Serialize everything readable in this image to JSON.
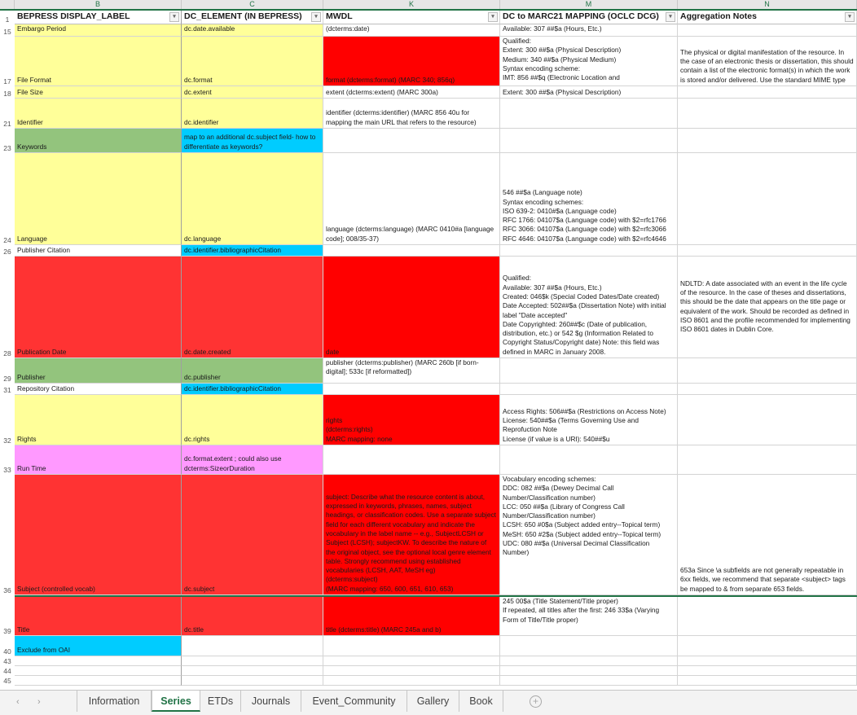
{
  "column_letters": [
    "B",
    "C",
    "K",
    "M",
    "N"
  ],
  "header_row": {
    "row_number": "1",
    "cells": [
      "BEPRESS DISPLAY_LABEL",
      "DC_ELEMENT (IN BEPRESS)",
      "MWDL",
      "DC to MARC21 MAPPING (OCLC DCG)",
      "Aggregation Notes"
    ],
    "filter_icon": "▾"
  },
  "rows": [
    {
      "num": "15",
      "B": "Embargo Period",
      "C": "dc.date.available",
      "K": "(dcterms:date)",
      "M": "Available: 307 ##$a (Hours, Etc.)",
      "N": ""
    },
    {
      "num": "17",
      "B": "File Format",
      "C": "dc.format",
      "K": "format (dcterms:format) (MARC 340; 856q)",
      "M": "Qualified:\nExtent: 300 ##$a (Physical Description)\nMedium: 340 ##$a (Physical Medium)\nSyntax encoding scheme:\nIMT: 856 ##$q (Electronic Location and",
      "N": "The physical or digital manifestation of the resource. In the case of an electronic thesis or dissertation, this should contain a list of the electronic format(s) in which the work is stored and/or delivered. Use the standard MIME type"
    },
    {
      "num": "18",
      "B": "File Size",
      "C": "dc.extent",
      "K": "extent (dcterms:extent) (MARC 300a)",
      "M": "Extent: 300 ##$a (Physical Description)",
      "N": ""
    },
    {
      "num": "21",
      "B": "Identifier",
      "C": "dc.identifier",
      "K": "identifier (dcterms:identifier) (MARC 856 40u for mapping the main URL that refers to the resource)",
      "M": "",
      "N": ""
    },
    {
      "num": "23",
      "B": "Keywords",
      "C": "map to an additional dc.subject field- how to differentiate as keywords?",
      "K": "",
      "M": "",
      "N": ""
    },
    {
      "num": "24",
      "B": "Language",
      "C": "dc.language",
      "K": "language (dcterms:language)  (MARC 0410#a [language code]; 008/35-37)",
      "M": "546 ##$a (Language note)\nSyntax encoding schemes:\nISO 639-2: 0410#$a (Language code)\nRFC 1766: 04107$a (Language code) with $2=rfc1766\nRFC 3066: 04107$a (Language code) with $2=rfc3066\nRFC 4646: 04107$a (Language code) with $2=rfc4646",
      "N": ""
    },
    {
      "num": "26",
      "B": "Publisher Citation",
      "C": "dc.identifier.bibliographicCitation",
      "K": "",
      "M": "",
      "N": ""
    },
    {
      "num": "28",
      "B": "Publication Date",
      "C": "dc.date.created",
      "K": "date",
      "M": "Qualified:\nAvailable: 307 ##$a (Hours, Etc.)\nCreated: 046$k (Special Coded Dates/Date created)\nDate Accepted: 502##$a (Dissertation Note) with initial label \"Date accepted\"\nDate Copyrighted: 260##$c (Date of publication, distribution, etc.) or 542 $g (Information Related to Copyright Status/Copyright date) Note: this field was defined in MARC in January 2008.",
      "N": "NDLTD: A date associated with an event in the life cycle of the resource. In the case of theses and dissertations, this should be the date that appears on the title page or equivalent of the work.  Should be recorded as defined in ISO 8601 and the profile recommended for implementing ISO 8601 dates in Dublin Core."
    },
    {
      "num": "29",
      "B": "Publisher",
      "C": "dc.publisher",
      "K": "publisher (dcterms:publisher) (MARC 260b [if born-digital]; 533c [if reformatted])",
      "M": "",
      "N": ""
    },
    {
      "num": "31",
      "B": "Repository Citation",
      "C": "dc.identifier.bibliographicCitation",
      "K": "",
      "M": "",
      "N": ""
    },
    {
      "num": "32",
      "B": "Rights",
      "C": "dc.rights",
      "K": "rights\n(dcterms:rights)\nMARC mapping: none",
      "M": "Access Rights: 506##$a (Restrictions on Access Note)\nLicense: 540##$a (Terms Governing Use and Reprofuction Note\nLicense (if value is a URI): 540##$u",
      "N": ""
    },
    {
      "num": "33",
      "B": "Run Time",
      "C": "dc.format.extent ; could also use dcterms:SizeorDuration",
      "K": "",
      "M": "",
      "N": ""
    },
    {
      "num": "36",
      "B": "Subject (controlled vocab)",
      "C": "dc.subject",
      "K": "subject: Describe what the resource content is about, expressed in keywords, phrases, names, subject headings, or classification codes. Use a separate subject field for each different vocabulary and indicate the vocabulary in the label name  -- e.g., SubjectLCSH or Subject (LCSH); subjectKW. To describe the nature of the original object, see the optional local genre element table. Strongly recommend using established vocabularies (LCSH, AAT, MeSH eg)\n(dcterms:subject)\n(MARC mapping: 650, 600, 651, 610, 653)",
      "M": "Vocabulary encoding schemes:\nDDC: 082 ##$a (Dewey Decimal Call Number/Classification number)\nLCC: 050 ##$a (Library of Congress Call Number/Classification number)\nLCSH: 650 #0$a (Subject added entry--Topical term)\nMeSH: 650 #2$a (Subject added entry--Topical term)\nUDC: 080 ##$a (Universal Decimal Classification Number)",
      "N": "653a Since \\a subfields are not generally repeatable in 6xx fields, we recommend that separate <subject> tags be mapped to & from separate 653 fields."
    },
    {
      "num": "39",
      "B": "Title",
      "C": "dc.title",
      "K": "title (dcterms:title) (MARC 245a and b)",
      "M": "245 00$a (Title Statement/Title proper)\nIf repeated, all titles after the first: 246 33$a (Varying Form of Title/Title proper)",
      "N": ""
    },
    {
      "num": "40",
      "B": "Exclude from OAI",
      "C": "",
      "K": "",
      "M": "",
      "N": ""
    },
    {
      "num": "43",
      "B": "",
      "C": "",
      "K": "",
      "M": "",
      "N": ""
    },
    {
      "num": "44",
      "B": "",
      "C": "",
      "K": "",
      "M": "",
      "N": ""
    },
    {
      "num": "45",
      "B": "",
      "C": "",
      "K": "",
      "M": "",
      "N": ""
    }
  ],
  "sheet_tabs": {
    "nav_prev": "‹",
    "nav_next": "›",
    "tabs": [
      "Information",
      "Series",
      "ETDs",
      "Journals",
      "Event_Community",
      "Gallery",
      "Book"
    ],
    "active": "Series",
    "add_icon": "+"
  },
  "fill_colors": {
    "yellow": "#ffff99",
    "green": "#93c47d",
    "cyan": "#00ccff",
    "red": "#ff0000",
    "light_red": "#ff3333",
    "pink": "#ff99ff",
    "excel_green": "#217346"
  }
}
